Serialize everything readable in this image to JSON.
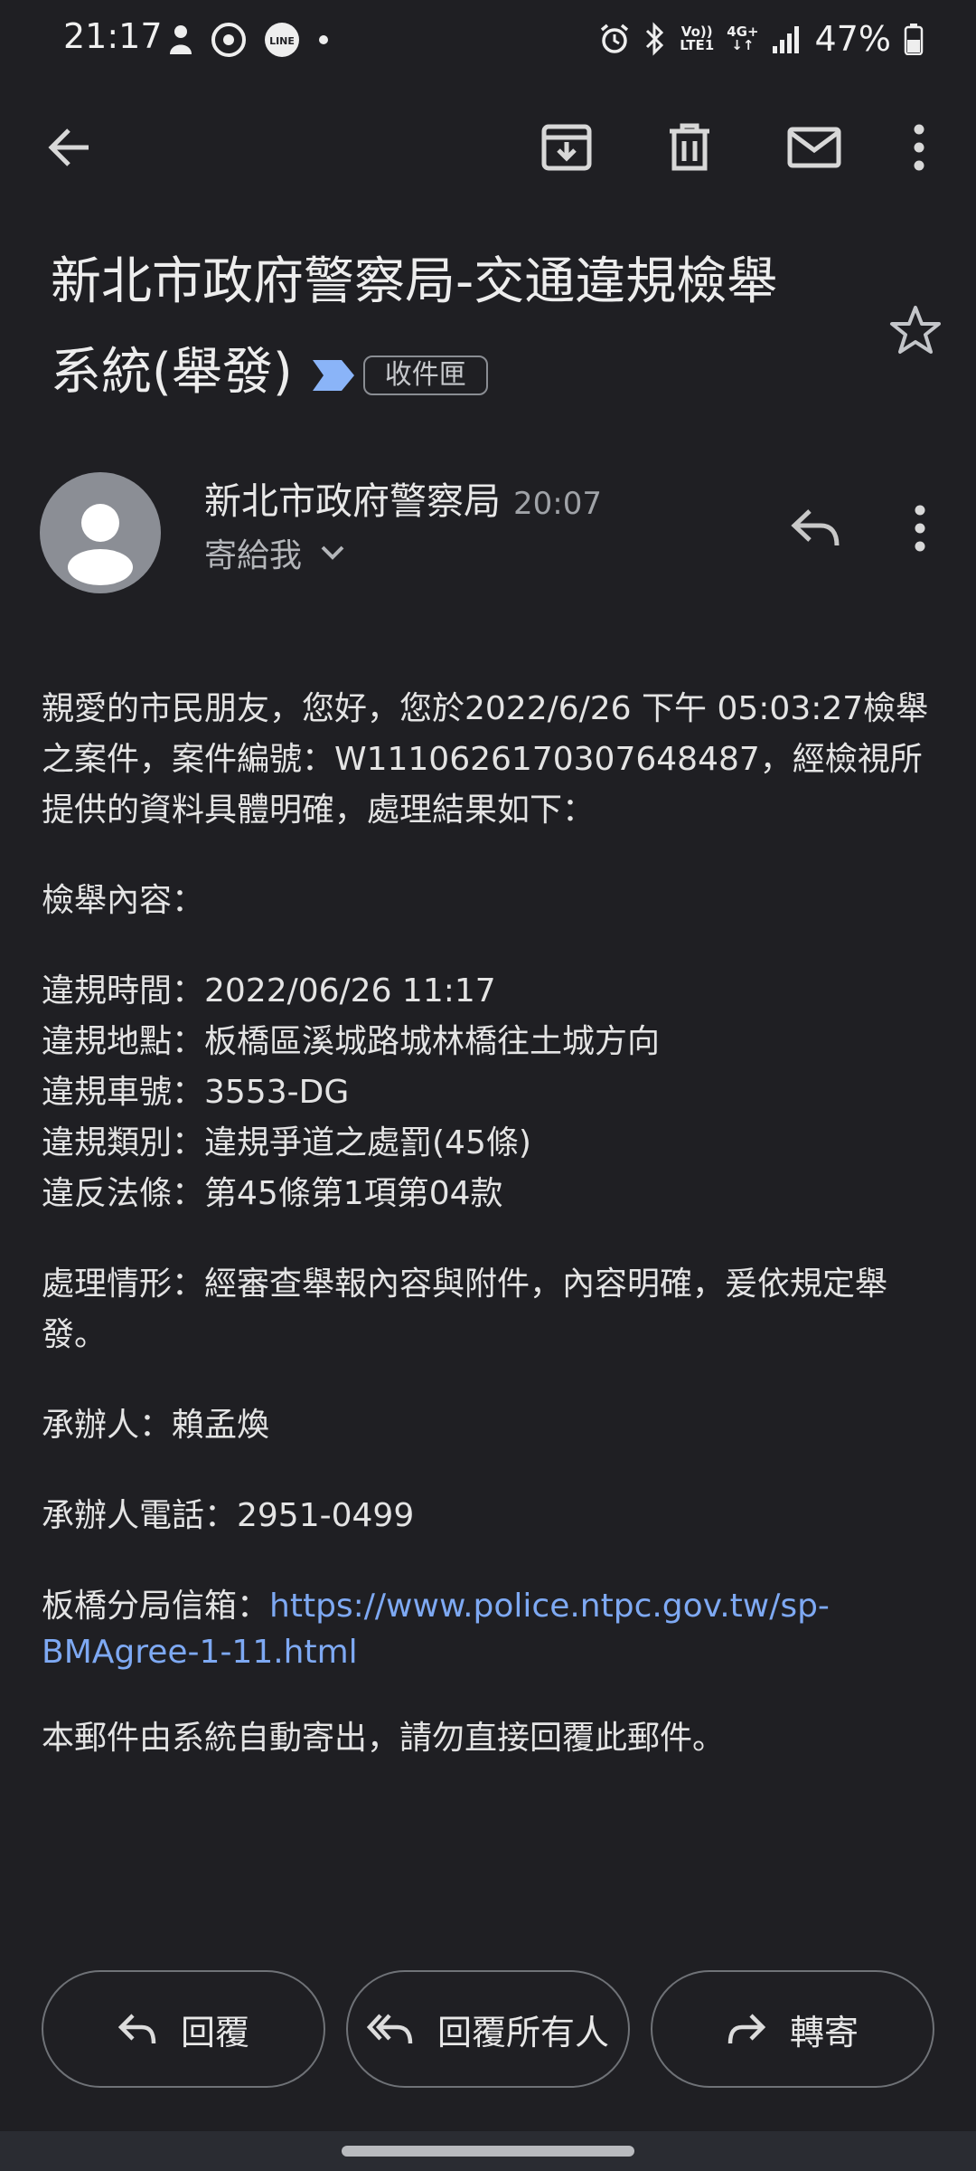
{
  "status_bar": {
    "time": "21:17",
    "volte_label": "Vo))",
    "lte_label": "LTE1",
    "network_label": "4G+",
    "battery_percent": "47%"
  },
  "toolbar": {
    "icons": [
      "back-arrow-icon",
      "archive-icon",
      "delete-icon",
      "mark-unread-icon",
      "more-vert-icon"
    ]
  },
  "email": {
    "subject_line1": "新北市政府警察局-交通違規檢舉",
    "subject_line2": "系統(舉發)",
    "label_chip": "收件匣",
    "sender_name": "新北市政府警察局",
    "sent_time": "20:07",
    "recipient_summary": "寄給我",
    "body": {
      "intro_1": "親愛的市民朋友，您好，您於2022/6/26 下午 05:03:27檢舉",
      "intro_2": "之案件，案件編號：W1110626170307648487，經檢視所",
      "intro_3": "提供的資料具體明確，處理結果如下：",
      "section_heading": "檢舉內容：",
      "violation_time": "違規時間：2022/06/26 11:17",
      "violation_location": "違規地點：板橋區溪城路城林橋往土城方向",
      "violation_plate": "違規車號：3553-DG",
      "violation_type": "違規類別：違規爭道之處罰(45條)",
      "violation_law": "違反法條：第45條第1項第04款",
      "status_1": "處理情形：經審查舉報內容與附件，內容明確，爰依規定舉",
      "status_2": "發。",
      "handler": "承辦人：賴孟煥",
      "handler_phone": "承辦人電話：2951-0499",
      "mailbox_label": "板橋分局信箱：",
      "mailbox_link_1": "https://www.police.ntpc.gov.tw/sp-",
      "mailbox_link_2": "BMAgree-1-11.html",
      "footer_note": "本郵件由系統自動寄出，請勿直接回覆此郵件。"
    }
  },
  "actions": {
    "reply": "回覆",
    "reply_all": "回覆所有人",
    "forward": "轉寄"
  },
  "colors": {
    "background": "#1f1f23",
    "link": "#7ea9f3",
    "label_arrow": "#8ab4f8"
  }
}
